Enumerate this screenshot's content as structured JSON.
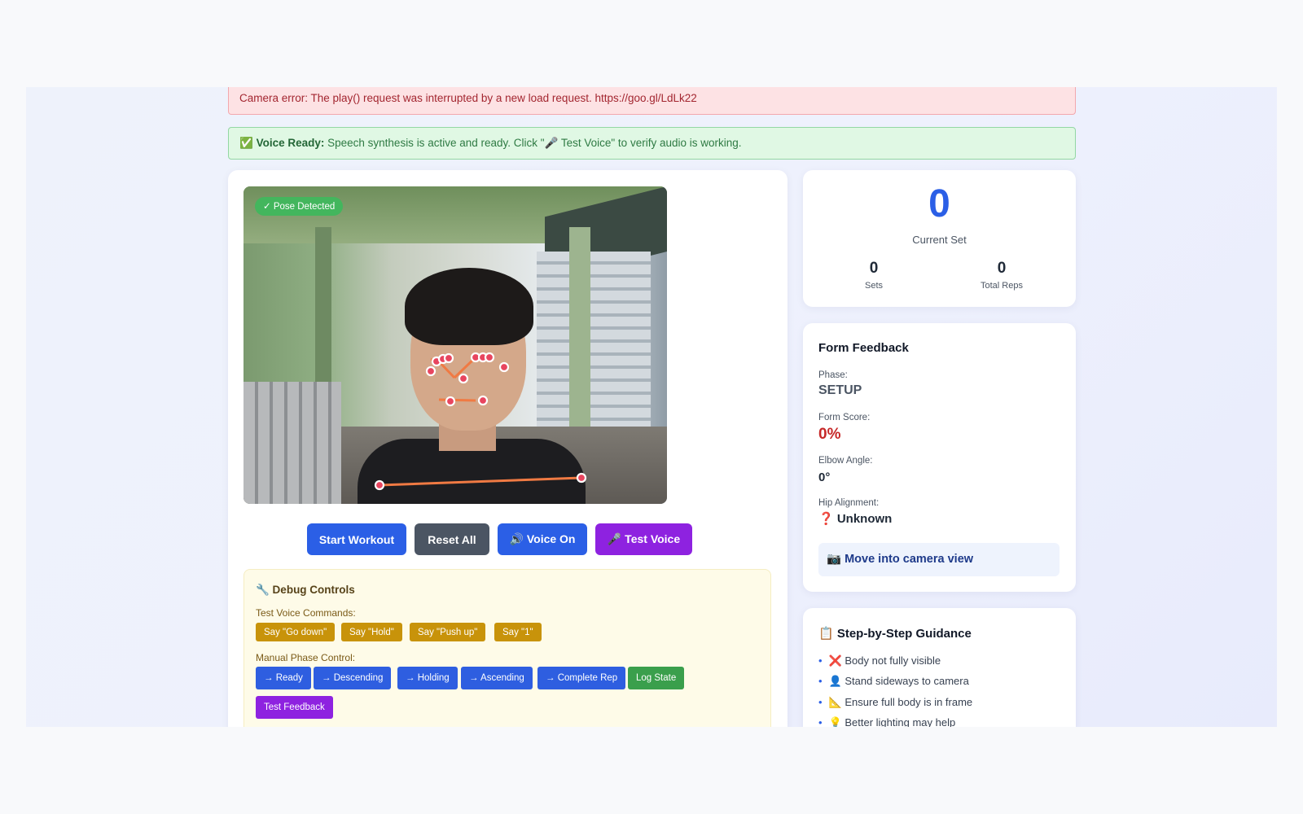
{
  "alerts": {
    "error": "Camera error: The play() request was interrupted by a new load request. https://goo.gl/LdLk22",
    "success_icon": "✅",
    "success_bold": "Voice Ready:",
    "success_text": " Speech synthesis is active and ready. Click \"🎤 Test Voice\" to verify audio is working."
  },
  "video": {
    "badge": "✓ Pose Detected"
  },
  "controls": {
    "start": "Start Workout",
    "reset": "Reset All",
    "voice": "🔊 Voice On",
    "test_voice": "🎤 Test Voice"
  },
  "debug": {
    "title": "🔧 Debug Controls",
    "voice_label": "Test Voice Commands:",
    "voice_buttons": [
      "Say \"Go down\"",
      "Say \"Hold\"",
      "Say \"Push up\"",
      "Say \"1\""
    ],
    "phase_label": "Manual Phase Control:",
    "phase_buttons": [
      "→ Ready",
      "→ Descending",
      "→ Holding",
      "→ Ascending",
      "→ Complete Rep",
      "Log State",
      "Test Feedback"
    ]
  },
  "stats": {
    "current_set": "0",
    "current_set_label": "Current Set",
    "sets": "0",
    "sets_label": "Sets",
    "total_reps": "0",
    "total_reps_label": "Total Reps"
  },
  "feedback": {
    "title": "Form Feedback",
    "phase_label": "Phase:",
    "phase": "SETUP",
    "score_label": "Form Score:",
    "score": "0%",
    "elbow_label": "Elbow Angle:",
    "elbow": "0°",
    "hip_label": "Hip Alignment:",
    "hip": "❓ Unknown",
    "message": "📷 Move into camera view"
  },
  "guidance": {
    "title": "📋 Step-by-Step Guidance",
    "items": [
      "❌ Body not fully visible",
      "👤 Stand sideways to camera",
      "📐 Ensure full body is in frame",
      "💡 Better lighting may help"
    ]
  },
  "colors": {
    "primary": "#2b5fe6",
    "secondary": "#4b5563",
    "purple": "#8e22e0",
    "success": "#43b65d",
    "danger": "#c62828",
    "skeleton_line": "#f07a43",
    "skeleton_point": "#e8455f"
  }
}
